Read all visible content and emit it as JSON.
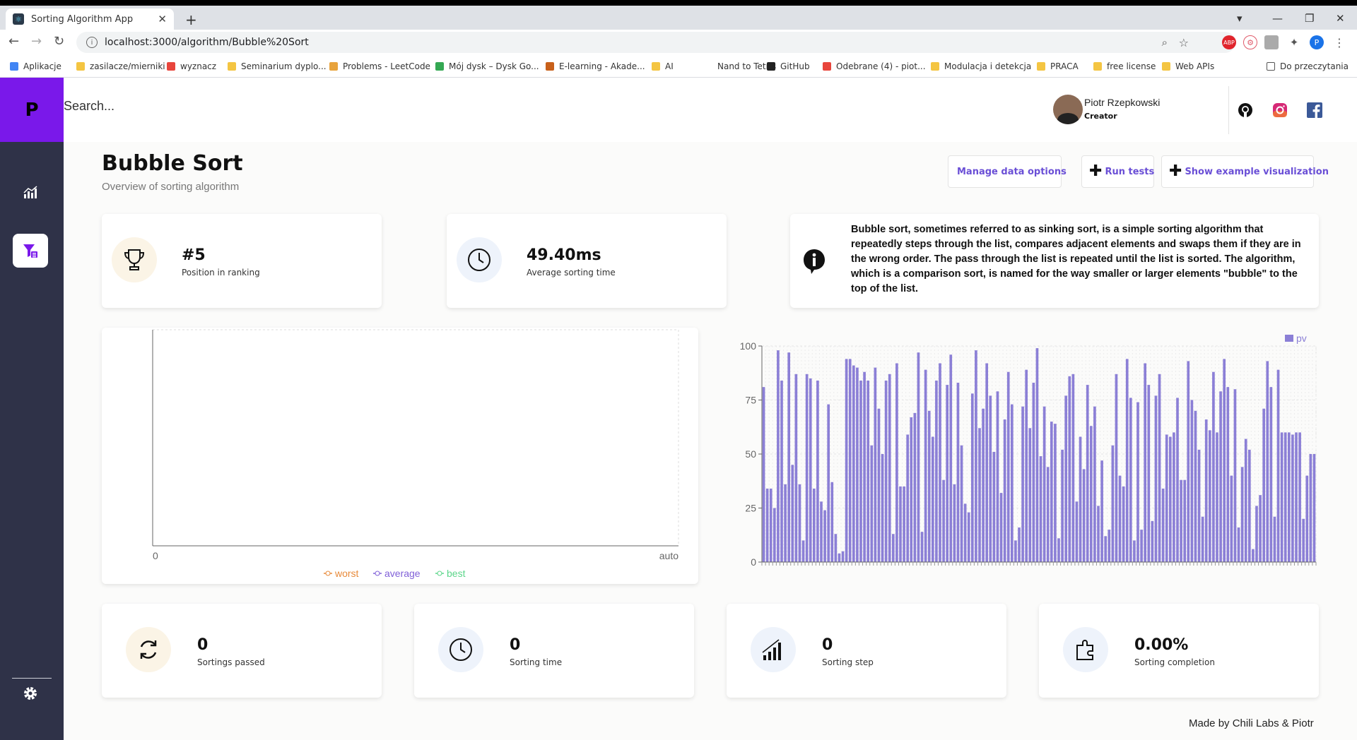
{
  "browser": {
    "tab_title": "Sorting Algorithm App",
    "url": "localhost:3000/algorithm/Bubble%20Sort",
    "bookmarks": [
      {
        "label": "Aplikacje",
        "color": "#4285f4"
      },
      {
        "label": "zasilacze/mierniki",
        "color": "#f4c542"
      },
      {
        "label": "wyznacz",
        "color": "#e8453c"
      },
      {
        "label": "Seminarium dyplo...",
        "color": "#f4c542"
      },
      {
        "label": "Problems - LeetCode",
        "color": "#e8a33c"
      },
      {
        "label": "Mój dysk – Dysk Go...",
        "color": "#34a853"
      },
      {
        "label": "E-learning - Akade...",
        "color": "#c8601a"
      },
      {
        "label": "AI",
        "color": "#f4c542"
      },
      {
        "label": "Nand to Tetris",
        "color": "#ffffff"
      },
      {
        "label": "GitHub",
        "color": "#222222"
      },
      {
        "label": "Odebrane (4) - piot...",
        "color": "#e8453c"
      },
      {
        "label": "Modulacja i detekcja",
        "color": "#f4c542"
      },
      {
        "label": "PRACA",
        "color": "#f4c542"
      },
      {
        "label": "free license",
        "color": "#f4c542"
      },
      {
        "label": "Web APIs",
        "color": "#f4c542"
      }
    ],
    "reading_list": "Do przeczytania",
    "profile_initial": "P"
  },
  "app": {
    "logo": "P",
    "search_placeholder": "Search...",
    "user": {
      "name": "Piotr Rzepkowski",
      "role": "Creator"
    }
  },
  "page": {
    "title": "Bubble Sort",
    "subtitle": "Overview of sorting algorithm",
    "buttons": {
      "manage": "Manage data options",
      "run": "Run tests",
      "example": "Show example visualization"
    }
  },
  "stats_top": {
    "ranking_value": "#5",
    "ranking_label": "Position in ranking",
    "avg_time_value": "49.40ms",
    "avg_time_label": "Average sorting time"
  },
  "description": "Bubble sort, sometimes referred to as sinking sort, is a simple sorting algorithm that repeatedly steps through the list, compares adjacent elements and swaps them if they are in the wrong order. The pass through the list is repeated until the list is sorted. The algorithm, which is a comparison sort, is named for the way smaller or larger elements \"bubble\" to the top of the list.",
  "stats_bottom": [
    {
      "value": "0",
      "label": "Sortings passed",
      "icon": "refresh-icon"
    },
    {
      "value": "0",
      "label": "Sorting time",
      "icon": "clock-icon"
    },
    {
      "value": "0",
      "label": "Sorting step",
      "icon": "bars-icon"
    },
    {
      "value": "0.00%",
      "label": "Sorting completion",
      "icon": "puzzle-icon"
    }
  ],
  "footer": "Made by Chili Labs & Piotr",
  "colors": {
    "accent": "#6a4fd6",
    "bar": "#8b7fd6",
    "sidebar": "#2f3248",
    "logo": "#7a18ea"
  },
  "chart_data": [
    {
      "type": "line",
      "x_ticks": [
        "0",
        "auto"
      ],
      "legend": [
        {
          "name": "worst",
          "color": "#e88a3a"
        },
        {
          "name": "average",
          "color": "#8060d8"
        },
        {
          "name": "best",
          "color": "#5cd68a"
        }
      ],
      "series": []
    },
    {
      "type": "bar",
      "legend": [
        "pv"
      ],
      "ylim": [
        0,
        100
      ],
      "y_ticks": [
        0,
        25,
        50,
        75,
        100
      ],
      "values": [
        81,
        34,
        34,
        25,
        98,
        84,
        36,
        97,
        45,
        87,
        36,
        10,
        87,
        85,
        34,
        84,
        28,
        24,
        73,
        37,
        13,
        4,
        5,
        94,
        94,
        91,
        90,
        84,
        88,
        84,
        54,
        90,
        71,
        50,
        84,
        87,
        13,
        92,
        35,
        35,
        59,
        67,
        69,
        97,
        14,
        89,
        70,
        58,
        84,
        92,
        38,
        82,
        96,
        36,
        83,
        54,
        27,
        23,
        78,
        98,
        62,
        71,
        92,
        77,
        51,
        79,
        32,
        66,
        88,
        73,
        10,
        16,
        72,
        89,
        62,
        83,
        99,
        49,
        72,
        44,
        65,
        64,
        11,
        52,
        77,
        86,
        87,
        28,
        58,
        43,
        82,
        63,
        72,
        26,
        47,
        12,
        15,
        54,
        87,
        40,
        35,
        94,
        76,
        10,
        74,
        15,
        92,
        82,
        19,
        77,
        87,
        34,
        59,
        58,
        60,
        76,
        38,
        38,
        93,
        75,
        70,
        52,
        21,
        66,
        61,
        88,
        60,
        79,
        94,
        81,
        40,
        80,
        16,
        44,
        57,
        52,
        6,
        26,
        31,
        71,
        93,
        81,
        21,
        89,
        60,
        60,
        60,
        59,
        60,
        60,
        20,
        40,
        50,
        50
      ]
    }
  ]
}
